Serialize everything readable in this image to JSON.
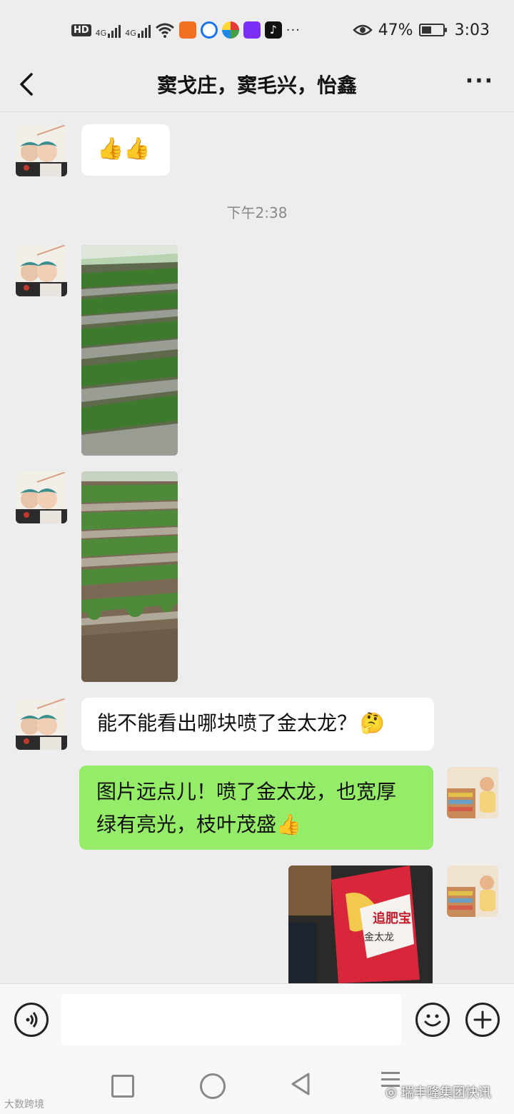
{
  "status_bar": {
    "hd": "HD",
    "signal1": "4G",
    "signal2": "4G",
    "more": "···",
    "battery_text": "47%",
    "battery_level": 0.47,
    "time": "3:03"
  },
  "header": {
    "title": "窦戈庄，窦毛兴，怡鑫",
    "back_icon": "chevron-left-icon",
    "more_icon": "more-dots-icon",
    "more": "···"
  },
  "messages": {
    "timestamp": "下午2:38",
    "m1": {
      "sender": "left",
      "content": "👍👍"
    },
    "m4": {
      "sender": "left",
      "text": "能不能看出哪块喷了金太龙？",
      "emoji": "🤔"
    },
    "m5": {
      "sender": "right",
      "line1": "图片远点儿！喷了金太龙，也宽厚",
      "line2": "绿有亮光，枝叶茂盛",
      "emoji": "👍"
    },
    "m6": {
      "bag_text1": "追肥宝",
      "bag_text2": "金太龙"
    }
  },
  "input_bar": {
    "voice_icon": "voice-icon",
    "emoji_icon": "emoji-icon",
    "plus_icon": "plus-icon"
  },
  "watermarks": {
    "left": "大数跨境",
    "right": "瑞丰隆集团快讯"
  },
  "colors": {
    "background": "#ededed",
    "bubble_green": "#95ec69",
    "bubble_white": "#ffffff"
  }
}
